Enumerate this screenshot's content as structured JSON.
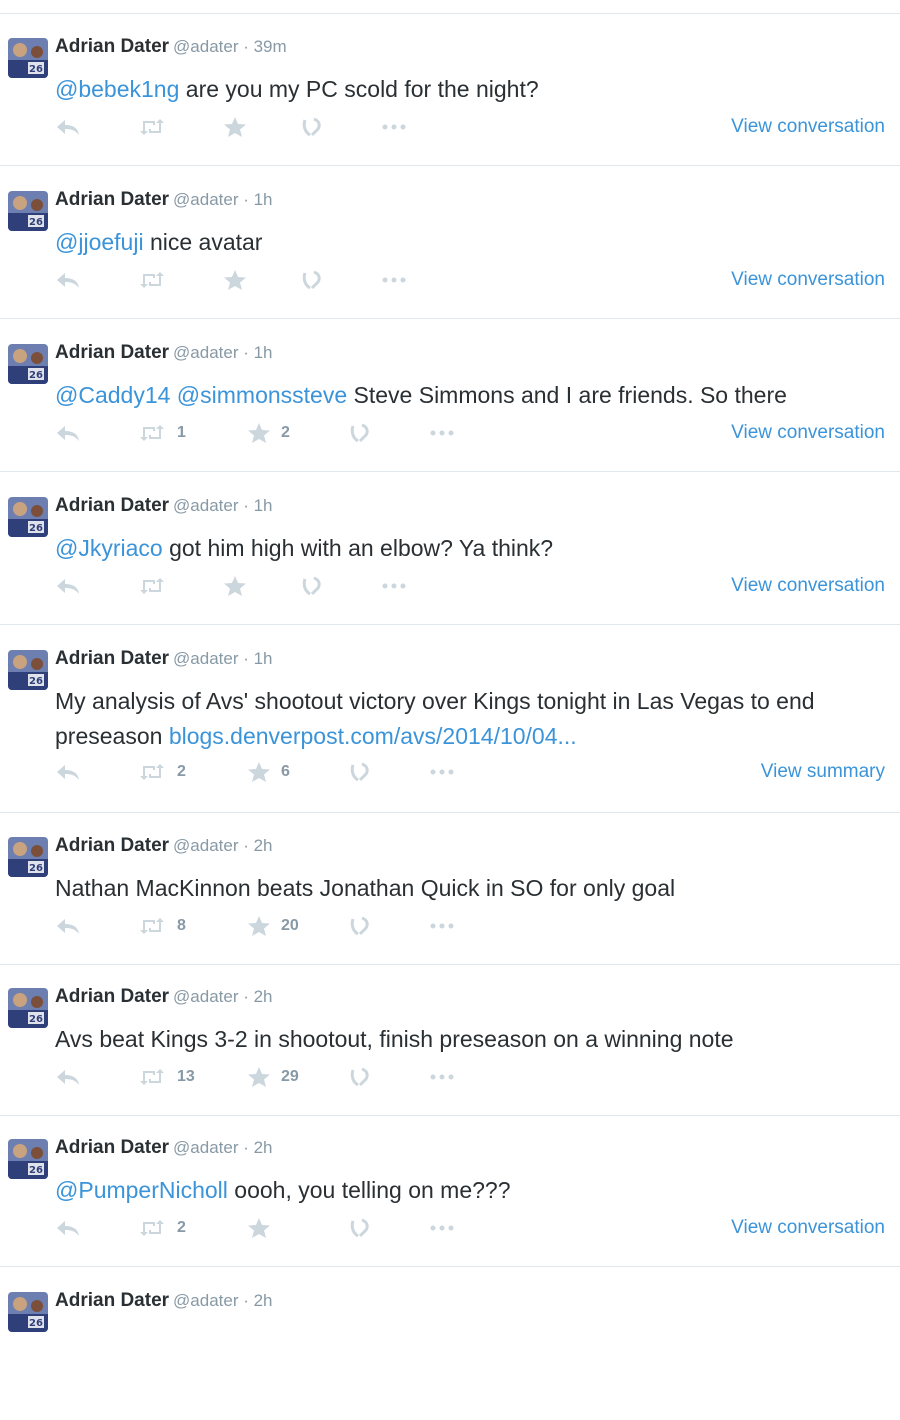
{
  "colors": {
    "link": "#3b94d9",
    "muted": "#8899a6",
    "text": "#292f33",
    "divider": "#e1e8ed"
  },
  "icons": [
    "reply-icon",
    "retweet-icon",
    "favorite-icon",
    "vine-icon",
    "more-icon"
  ],
  "tweets": [
    {
      "name": "Adrian Dater",
      "meta": "@adater · 39m",
      "mentions": "@bebek1ng",
      "text": " are you my PC scold for the night?",
      "text2": "",
      "link": "",
      "retweets": "",
      "favorites": "",
      "view": "View conversation"
    },
    {
      "name": "Adrian Dater",
      "meta": "@adater · 1h",
      "mentions": "@jjoefuji",
      "text": " nice avatar",
      "text2": "",
      "link": "",
      "retweets": "",
      "favorites": "",
      "view": "View conversation"
    },
    {
      "name": "Adrian Dater",
      "meta": "@adater · 1h",
      "mentions": "@Caddy14 @simmonssteve",
      "text": " Steve Simmons and I are friends. So there",
      "text2": "",
      "link": "",
      "retweets": "1",
      "favorites": "2",
      "view": "View conversation"
    },
    {
      "name": "Adrian Dater",
      "meta": "@adater · 1h",
      "mentions": "@Jkyriaco",
      "text": " got him high with an elbow? Ya think?",
      "text2": "",
      "link": "",
      "retweets": "",
      "favorites": "",
      "view": "View conversation"
    },
    {
      "name": "Adrian Dater",
      "meta": "@adater · 1h",
      "mentions": "",
      "text": "My analysis of Avs' shootout victory over Kings tonight in Las Vegas to end preseason ",
      "text2": "",
      "link": "blogs.denverpost.com/avs/2014/10/04...",
      "retweets": "2",
      "favorites": "6",
      "view": "View summary"
    },
    {
      "name": "Adrian Dater",
      "meta": "@adater · 2h",
      "mentions": "",
      "text": "Nathan MacKinnon beats Jonathan Quick in SO for only goal",
      "text2": "",
      "link": "",
      "retweets": "8",
      "favorites": "20",
      "view": ""
    },
    {
      "name": "Adrian Dater",
      "meta": "@adater · 2h",
      "mentions": "",
      "text": "Avs beat Kings 3-2 in shootout, finish preseason on a winning note",
      "text2": "",
      "link": "",
      "retweets": "13",
      "favorites": "29",
      "view": ""
    },
    {
      "name": "Adrian Dater",
      "meta": "@adater · 2h",
      "mentions": "@PumperNicholl",
      "text": " oooh, you telling on me???",
      "text2": "",
      "link": "",
      "retweets": "2",
      "favorites": "",
      "view": "View conversation"
    },
    {
      "name": "Adrian Dater",
      "meta": "@adater · 2h",
      "mentions": "",
      "text": "",
      "text2": "",
      "link": "",
      "retweets": "",
      "favorites": "",
      "view": ""
    }
  ]
}
